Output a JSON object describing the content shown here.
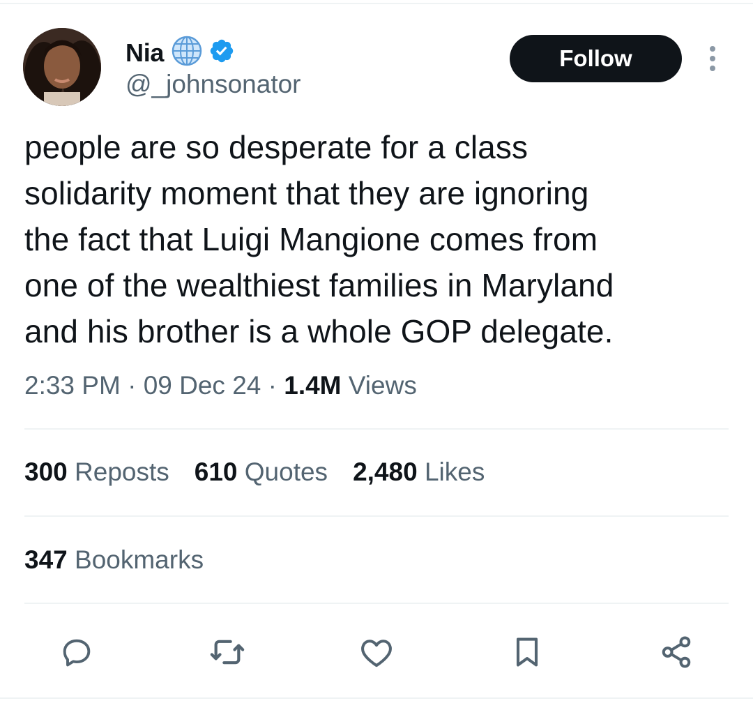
{
  "author": {
    "display_name": "Nia",
    "handle": "@_johnsonator",
    "badges": [
      "globe-icon",
      "verified-icon"
    ]
  },
  "header": {
    "follow_label": "Follow",
    "more_icon": "more-vertical-icon"
  },
  "tweet": {
    "text": "people are so desperate for a class\nsolidarity moment that they are ignoring\nthe fact that Luigi Mangione comes from\none of the wealthiest families in Maryland\nand his brother is a whole GOP delegate.",
    "time": "2:33 PM",
    "date": "09 Dec 24",
    "separator": "·",
    "views_count": "1.4M",
    "views_label": "Views"
  },
  "stats": {
    "reposts_count": "300",
    "reposts_label": "Reposts",
    "quotes_count": "610",
    "quotes_label": "Quotes",
    "likes_count": "2,480",
    "likes_label": "Likes",
    "bookmarks_count": "347",
    "bookmarks_label": "Bookmarks"
  },
  "actions": [
    "reply-icon",
    "repost-icon",
    "like-icon",
    "bookmark-icon",
    "share-icon"
  ],
  "colors": {
    "text": "#0f1419",
    "secondary": "#536471",
    "verified": "#1d9bf0",
    "divider": "#eff3f4"
  }
}
